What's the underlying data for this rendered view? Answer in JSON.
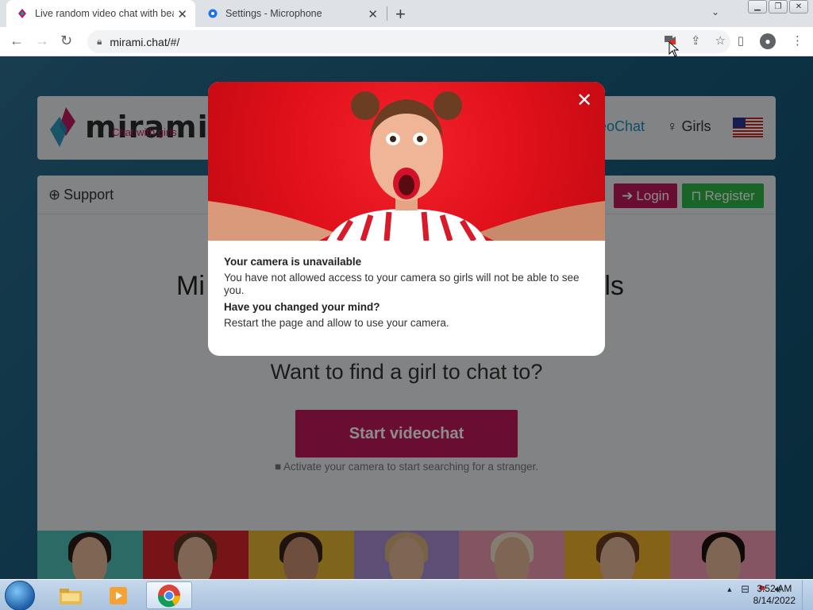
{
  "browser": {
    "tabs": [
      {
        "title": "Live random video chat with bea",
        "active": true
      },
      {
        "title": "Settings - Microphone",
        "active": false
      }
    ],
    "url": "mirami.chat/#/"
  },
  "site": {
    "logo_word": "mirami",
    "logo_tagline": "Chat with girls",
    "nav_videochat": "eoChat",
    "nav_girls": "Girls",
    "support_label": "Support",
    "login_label": "Login",
    "register_label": "Register",
    "headline_left": "Mi",
    "headline_right": "rls",
    "question": "Want to find a girl to chat to?",
    "start_button": "Start videochat",
    "hint": "Activate your camera to start searching for a stranger."
  },
  "modal": {
    "title1": "Your camera is unavailable",
    "text1": "You have not allowed access to your camera so girls will not be able to see you.",
    "title2": "Have you changed your mind?",
    "text2": "Restart the page and allow to use your camera."
  },
  "taskbar": {
    "time": "3:52 AM",
    "date": "8/14/2022"
  },
  "colors": {
    "brand_pink": "#c2185b",
    "register_green": "#2eb84a",
    "page_bg": "#175c7d"
  }
}
